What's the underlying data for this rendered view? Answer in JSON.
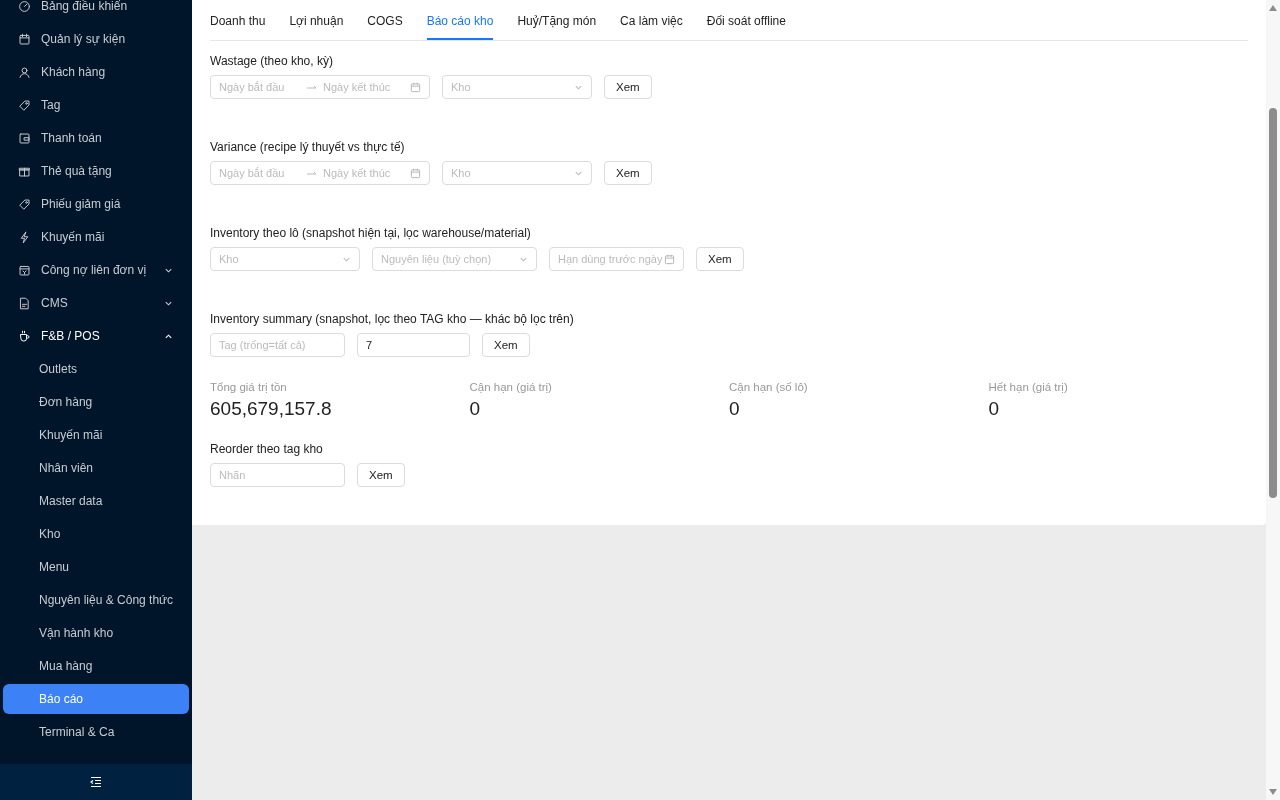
{
  "sidebar": {
    "items": [
      {
        "label": "Bảng điều khiển",
        "selected": false
      },
      {
        "label": "Quản lý sự kiện",
        "selected": false
      },
      {
        "label": "Khách hàng",
        "selected": false
      },
      {
        "label": "Tag",
        "selected": false
      },
      {
        "label": "Thanh toán",
        "selected": false
      },
      {
        "label": "Thẻ quà tặng",
        "selected": false
      },
      {
        "label": "Phiếu giảm giá",
        "selected": false
      },
      {
        "label": "Khuyến mãi",
        "selected": false
      },
      {
        "label": "Công nợ liên đơn vị",
        "selected": false,
        "expanded": false
      },
      {
        "label": "CMS",
        "selected": false,
        "expanded": false
      },
      {
        "label": "F&B / POS",
        "selected": false,
        "expanded": true,
        "children": [
          {
            "label": "Outlets",
            "selected": false
          },
          {
            "label": "Đơn hàng",
            "selected": false
          },
          {
            "label": "Khuyến mãi",
            "selected": false
          },
          {
            "label": "Nhân viên",
            "selected": false
          },
          {
            "label": "Master data",
            "selected": false
          },
          {
            "label": "Kho",
            "selected": false
          },
          {
            "label": "Menu",
            "selected": false
          },
          {
            "label": "Nguyên liệu & Công thức",
            "selected": false
          },
          {
            "label": "Vận hành kho",
            "selected": false
          },
          {
            "label": "Mua hàng",
            "selected": false
          },
          {
            "label": "Báo cáo",
            "selected": true
          },
          {
            "label": "Terminal & Ca",
            "selected": false
          }
        ]
      }
    ]
  },
  "tabs": [
    {
      "label": "Doanh thu",
      "selected": false
    },
    {
      "label": "Lợi nhuận",
      "selected": false
    },
    {
      "label": "COGS",
      "selected": false
    },
    {
      "label": "Báo cáo kho",
      "selected": true
    },
    {
      "label": "Huỷ/Tặng món",
      "selected": false
    },
    {
      "label": "Ca làm việc",
      "selected": false
    },
    {
      "label": "Đối soát offline",
      "selected": false
    }
  ],
  "sections": [
    {
      "title": "Wastage (theo kho, kỳ)",
      "controls": [
        {
          "kind": "date_range",
          "placeholder": "Ngày bắt đầu",
          "placeholder_end": "Ngày kết thúc"
        },
        {
          "kind": "select",
          "placeholder": "Kho"
        },
        {
          "kind": "button",
          "label": "Xem"
        }
      ]
    },
    {
      "title": "Variance (recipe lý thuyết vs thực tế)",
      "controls": [
        {
          "kind": "date_range",
          "placeholder": "Ngày bắt đầu",
          "placeholder_end": "Ngày kết thúc"
        },
        {
          "kind": "select",
          "placeholder": "Kho"
        },
        {
          "kind": "button",
          "label": "Xem"
        }
      ]
    },
    {
      "title": "Inventory theo lô (snapshot hiện tại, lọc warehouse/material)",
      "controls": [
        {
          "kind": "select",
          "placeholder": "Kho"
        },
        {
          "kind": "select",
          "placeholder": "Nguyên liệu (tuỳ chọn)"
        },
        {
          "kind": "date",
          "placeholder": "Hạn dùng trước ngày"
        },
        {
          "kind": "button",
          "label": "Xem"
        }
      ]
    },
    {
      "title": "Inventory summary (snapshot, lọc theo TAG kho — khác bộ lọc trên)",
      "controls": [
        {
          "kind": "input",
          "placeholder": "Tag (trống=tất cả)"
        },
        {
          "kind": "input",
          "value": "7"
        },
        {
          "kind": "button",
          "label": "Xem"
        }
      ],
      "stats": [
        {
          "label": "Tổng giá trị tồn",
          "value": "605,679,157.8"
        },
        {
          "label": "Cận hạn (giá trị)",
          "value": "0"
        },
        {
          "label": "Cận hạn (số lô)",
          "value": "0"
        },
        {
          "label": "Hết hạn (giá trị)",
          "value": "0"
        }
      ]
    },
    {
      "title": "Reorder theo tag kho",
      "controls": [
        {
          "kind": "input",
          "placeholder": "Nhãn"
        },
        {
          "kind": "button",
          "label": "Xem"
        }
      ]
    }
  ]
}
